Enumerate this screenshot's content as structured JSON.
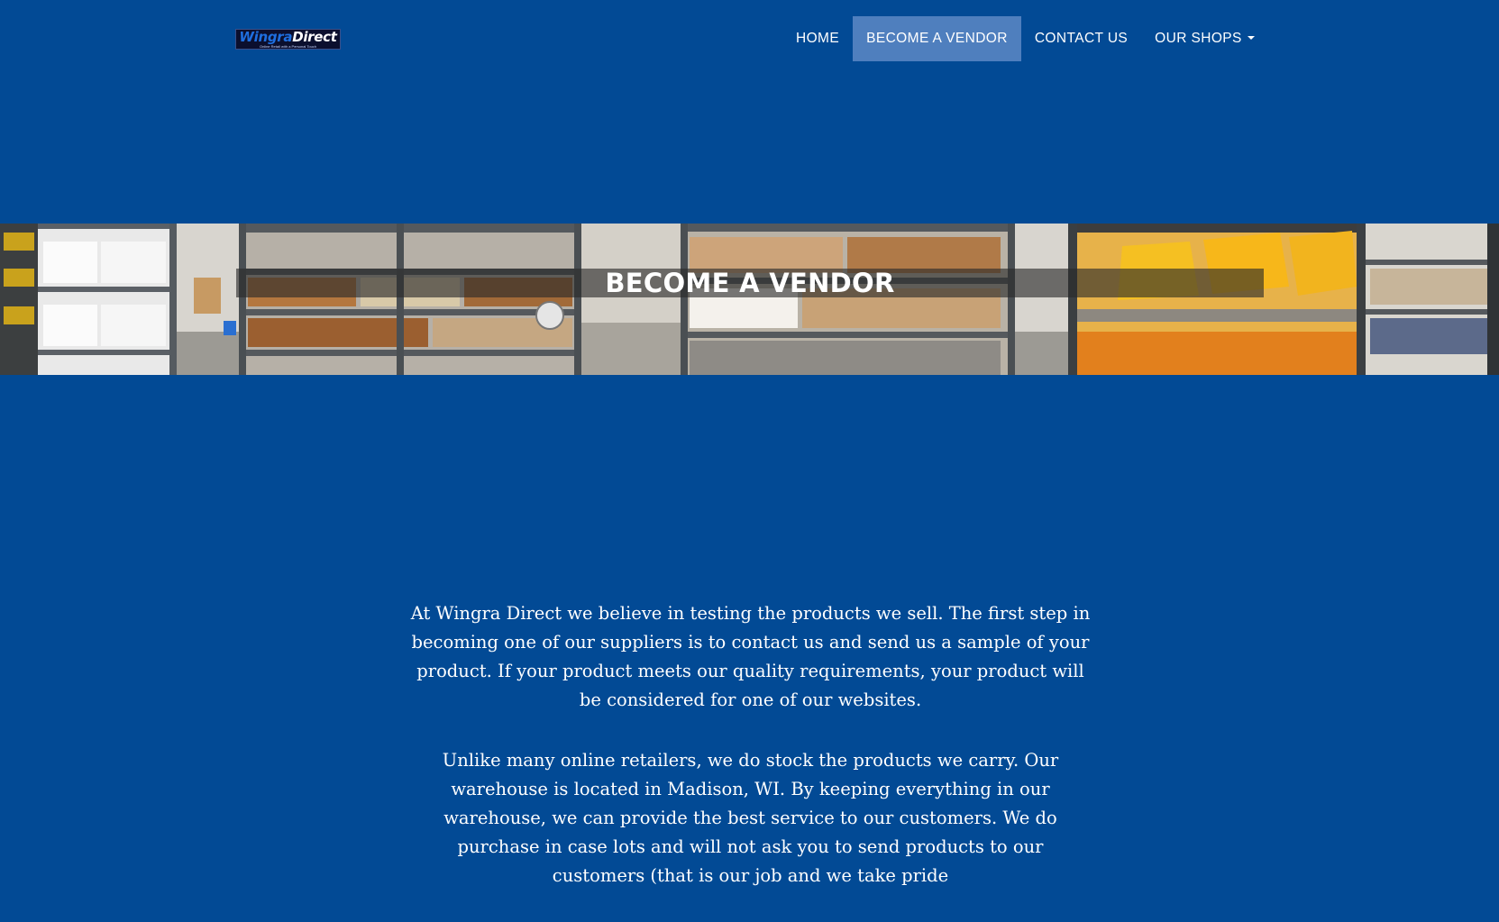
{
  "colors": {
    "page_background": "#024a95",
    "nav_active_background": "#4f7fbe",
    "title_bar_background": "rgba(40,40,40,0.62)"
  },
  "logo": {
    "word1": "Wingra",
    "word2": "Direct",
    "tagline": "Online Retail with a Personal Touch"
  },
  "nav": {
    "items": [
      {
        "label": "HOME",
        "active": false
      },
      {
        "label": "BECOME A VENDOR",
        "active": true
      },
      {
        "label": "CONTACT US",
        "active": false
      },
      {
        "label": "OUR SHOPS",
        "active": false,
        "dropdown": true
      }
    ]
  },
  "hero": {
    "title": "BECOME A VENDOR",
    "image": "warehouse-panorama"
  },
  "content": {
    "paragraphs": [
      "At Wingra Direct we believe in testing the products we sell. The first step in becoming one of our suppliers is to contact us and send us a sample of your product. If your product meets our quality requirements, your product will be considered for one of our websites.",
      "Unlike many online retailers, we do stock the products we carry. Our warehouse is located in Madison, WI. By keeping everything in our warehouse, we can provide the best service to our customers. We do purchase in case lots and will not ask you to send products to our customers (that is our job and we take pride"
    ]
  }
}
